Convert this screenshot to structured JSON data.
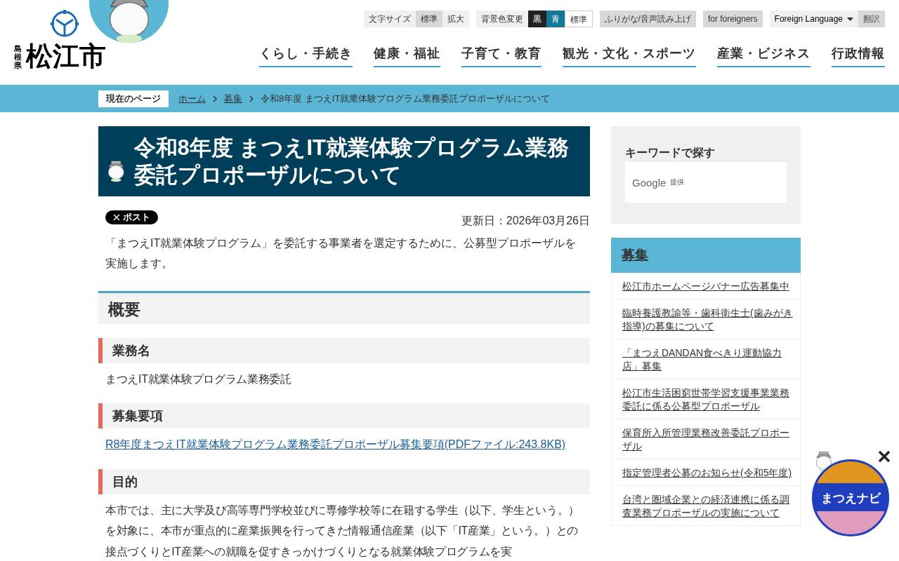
{
  "header": {
    "logo": {
      "prefecture": "島根県",
      "city": "松江市"
    },
    "font_size": {
      "label": "文字サイズ",
      "options": [
        {
          "label": "標準",
          "selected": true
        },
        {
          "label": "拡大",
          "selected": false
        }
      ]
    },
    "background_color": {
      "label": "背景色変更",
      "options": [
        {
          "label": "黒",
          "kind": "black"
        },
        {
          "label": "青",
          "kind": "blue"
        },
        {
          "label": "標準",
          "kind": "standard"
        }
      ]
    },
    "links": [
      "ふりがな/音声読み上げ",
      "for foreigners"
    ],
    "language": {
      "label": "Foreign Language",
      "button": "翻訳"
    },
    "nav": [
      "くらし・手続き",
      "健康・福祉",
      "子育て・教育",
      "観光・文化・スポーツ",
      "産業・ビジネス",
      "行政情報"
    ]
  },
  "breadcrumb": {
    "label": "現在のページ",
    "items": [
      {
        "text": "ホーム",
        "link": true
      },
      {
        "text": "募集",
        "link": true
      },
      {
        "text": "令和8年度 まつえIT就業体験プログラム業務委託プロポーザルについて",
        "link": false
      }
    ]
  },
  "article": {
    "title": "令和8年度 まつえIT就業体験プログラム業務委託プロポーザルについて",
    "share_button": "ポスト",
    "updated": "更新日：2026年03月26日",
    "intro": "「まつえIT就業体験プログラム」を委託する事業者を選定するために、公募型プロポーザルを実施します。",
    "overview_heading": "概要",
    "sections": [
      {
        "title": "業務名",
        "kind": "text",
        "body": "まつえIT就業体験プログラム業務委託"
      },
      {
        "title": "募集要項",
        "kind": "link",
        "body": "R8年度まつえIT就業体験プログラム業務委託プロポーザル募集要項(PDFファイル:243.8KB)"
      },
      {
        "title": "目的",
        "kind": "text",
        "body": "本市では、主に大学及び高等専門学校並びに専修学校等に在籍する学生（以下、学生という。）を対象に、本市が重点的に産業振興を行ってきた情報通信産業（以下「IT産業」という。）との接点づくりとIT産業への就職を促すきっかけづくりとなる就業体験プログラムを実"
      }
    ]
  },
  "sidebar": {
    "search": {
      "title": "キーワードで探す",
      "brand": "Google",
      "provider": "提供"
    },
    "category": {
      "title": "募集",
      "items": [
        "松江市ホームページバナー広告募集中",
        "臨時養護教諭等・歯科衛生士(歯みがき指導)の募集について",
        "「まつえDANDAN食べきり運動協力店」募集",
        "松江市生活困窮世帯学習支援事業業務委託に係る公募型プロポーザル",
        "保育所入所管理業務改善委託プロポーザル",
        "指定管理者公募のお知らせ(令和5年度)",
        "台湾と圏域企業との経済連携に係る調査業務プロポーザルの実施について"
      ]
    }
  },
  "floating_banner": {
    "label": "まつえナビ"
  }
}
